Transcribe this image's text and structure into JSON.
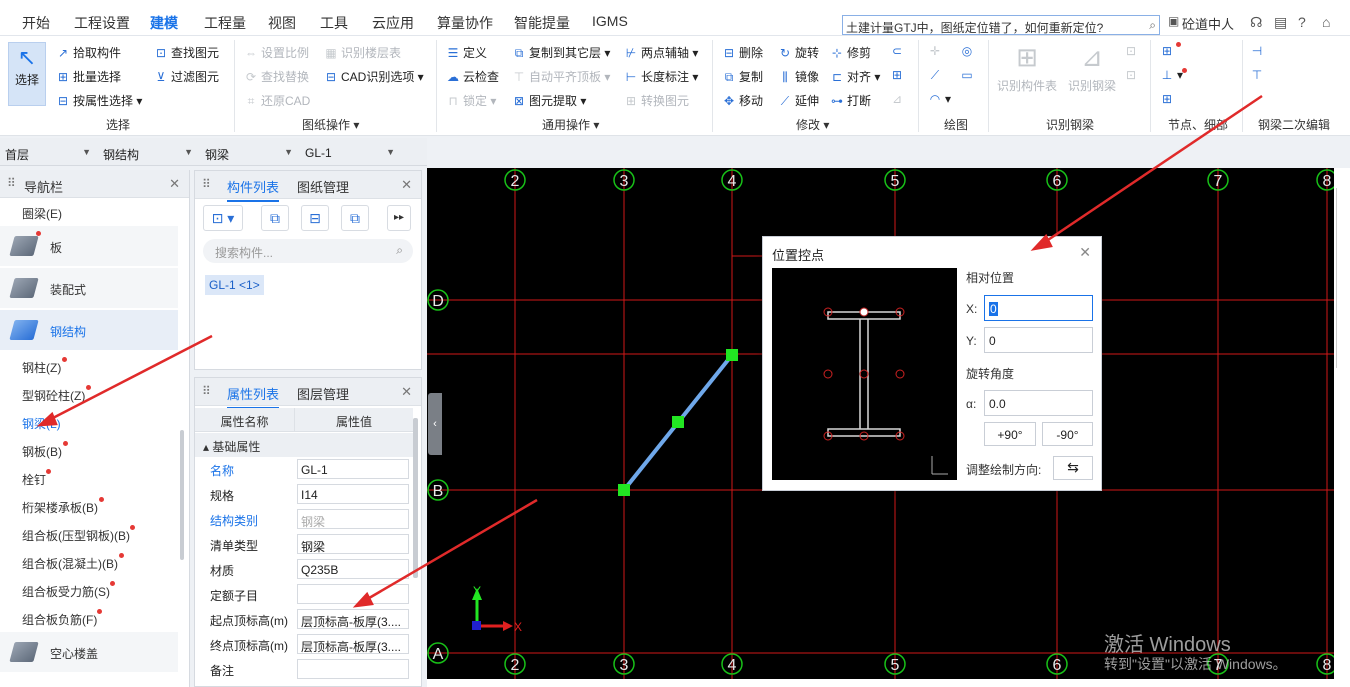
{
  "menu": {
    "items": [
      "开始",
      "工程设置",
      "建模",
      "工程量",
      "视图",
      "工具",
      "云应用",
      "算量协作",
      "智能提量",
      "IGMS"
    ],
    "active": "建模"
  },
  "search": {
    "text": "土建计量GTJ中，图纸定位错了，如何重新定位?"
  },
  "user": {
    "name": "砼道中人"
  },
  "ribbon": {
    "select": {
      "label": "选择"
    },
    "g1": [
      "拾取构件",
      "批量选择",
      "按属性选择"
    ],
    "g1b": [
      "查找图元",
      "过滤图元"
    ],
    "g2": [
      "设置比例",
      "查找替换",
      "还原CAD"
    ],
    "g2b": [
      "识别楼层表",
      "CAD识别选项"
    ],
    "g3": [
      "定义",
      "云检查",
      "锁定"
    ],
    "g3b": [
      "复制到其它层",
      "自动平齐顶板",
      "图元提取"
    ],
    "g3c": [
      "两点辅轴",
      "长度标注",
      "转换图元"
    ],
    "g4": [
      "删除",
      "复制",
      "移动"
    ],
    "g4b": [
      "旋转",
      "镜像",
      "延伸"
    ],
    "g4c": [
      "修剪",
      "对齐",
      "打断"
    ],
    "g6": [
      "识别构件表",
      "识别钢梁"
    ],
    "groups": [
      "选择",
      "图纸操作",
      "通用操作",
      "修改",
      "绘图",
      "识别钢梁",
      "节点、细部",
      "钢梁二次编辑"
    ]
  },
  "selectors": [
    "首层",
    "钢结构",
    "钢梁",
    "GL-1"
  ],
  "nav": {
    "title": "导航栏",
    "top_item": "圈梁(E)",
    "categories": [
      "板",
      "装配式",
      "钢结构",
      "空心楼盖"
    ],
    "active_category": "钢结构",
    "items": [
      "钢柱(Z)",
      "型钢砼柱(Z)",
      "钢梁(L)",
      "钢板(B)",
      "栓钉",
      "桁架楼承板(B)",
      "组合板(压型钢板)(B)",
      "组合板(混凝土)(B)",
      "组合板受力筋(S)",
      "组合板负筋(F)"
    ],
    "active_item": "钢梁(L)"
  },
  "components": {
    "tabs": [
      "构件列表",
      "图纸管理"
    ],
    "search_placeholder": "搜索构件...",
    "item": "GL-1 <1>"
  },
  "properties": {
    "tabs": [
      "属性列表",
      "图层管理"
    ],
    "col_name": "属性名称",
    "col_value": "属性值",
    "group": "基础属性",
    "rows": [
      {
        "label": "名称",
        "value": "GL-1"
      },
      {
        "label": "规格",
        "value": "I14"
      },
      {
        "label": "结构类别",
        "value": "钢梁"
      },
      {
        "label": "清单类型",
        "value": "钢梁"
      },
      {
        "label": "材质",
        "value": "Q235B"
      },
      {
        "label": "定额子目",
        "value": ""
      },
      {
        "label": "起点顶标高(m)",
        "value": "层顶标高-板厚(3...."
      },
      {
        "label": "终点顶标高(m)",
        "value": "层顶标高-板厚(3...."
      },
      {
        "label": "备注",
        "value": ""
      }
    ]
  },
  "canvas": {
    "axis_top": [
      "2",
      "3",
      "4",
      "5",
      "6",
      "7",
      "8"
    ],
    "axis_side": [
      "D",
      "B",
      "A"
    ],
    "ucs_x": "X",
    "ucs_y": "Y"
  },
  "dialog": {
    "title": "位置控点",
    "rel_pos": "相对位置",
    "x_label": "X:",
    "x_value": "0",
    "y_label": "Y:",
    "y_value": "0",
    "rot_label": "旋转角度",
    "alpha_label": "α:",
    "alpha_value": "0.0",
    "plus90": "+90°",
    "minus90": "-90°",
    "dir_label": "调整绘制方向:"
  },
  "watermark": {
    "line1": "激活 Windows",
    "line2": "转到\"设置\"以激活 Windows。"
  }
}
